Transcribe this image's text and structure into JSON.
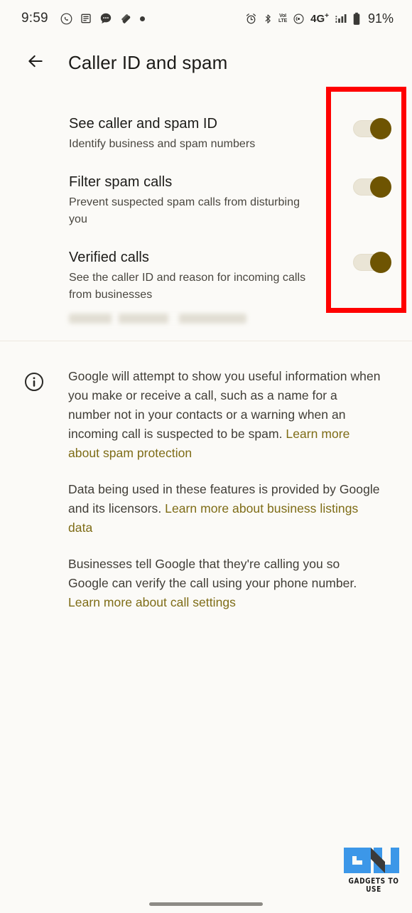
{
  "status_bar": {
    "time": "9:59",
    "left_icons": [
      "whatsapp-icon",
      "news-icon",
      "messages-icon",
      "app-icon",
      "dot-icon"
    ],
    "right_icons": [
      "alarm-icon",
      "bluetooth-icon",
      "volte-icon",
      "hotspot-icon"
    ],
    "volte_top": "VoI",
    "volte_bottom": "LTE",
    "network_type": "4G",
    "network_sup": "+",
    "signal": "signal-bars-icon",
    "battery": "battery-icon",
    "battery_percent": "91%"
  },
  "app_bar": {
    "back_icon": "back-arrow-icon",
    "title": "Caller ID and spam"
  },
  "settings": {
    "rows": [
      {
        "title": "See caller and spam ID",
        "subtitle": "Identify business and spam numbers",
        "toggle_state": "on"
      },
      {
        "title": "Filter spam calls",
        "subtitle": "Prevent suspected spam calls from disturbing you",
        "toggle_state": "on"
      },
      {
        "title": "Verified calls",
        "subtitle": "See the caller ID and reason for incoming calls from businesses",
        "toggle_state": "on"
      }
    ],
    "redacted_line": ""
  },
  "highlight": {
    "color": "#FF0000",
    "name": "toggles-highlight-box"
  },
  "info": {
    "icon": "info-circle-icon",
    "paragraphs": [
      {
        "text": "Google will attempt to show you useful information when you make or receive a call, such as a name for a number not in your contacts or a warning when an incoming call is suspected to be spam. ",
        "link": "Learn more about spam protection",
        "tail": ""
      },
      {
        "text": "Data being used in these features is provided by Google and its licensors. ",
        "link": "Learn more about business listings data",
        "tail": ""
      },
      {
        "text": "Businesses tell Google that they're calling you so Google can verify the call using your phone number. ",
        "link": "Learn more about call settings",
        "tail": ""
      }
    ],
    "link_color": "#7E6C16"
  },
  "watermark": {
    "text": "GADGETS TO USE",
    "accent": "#3C97E8"
  },
  "nav_bar": {
    "home_indicator": "home-indicator"
  }
}
